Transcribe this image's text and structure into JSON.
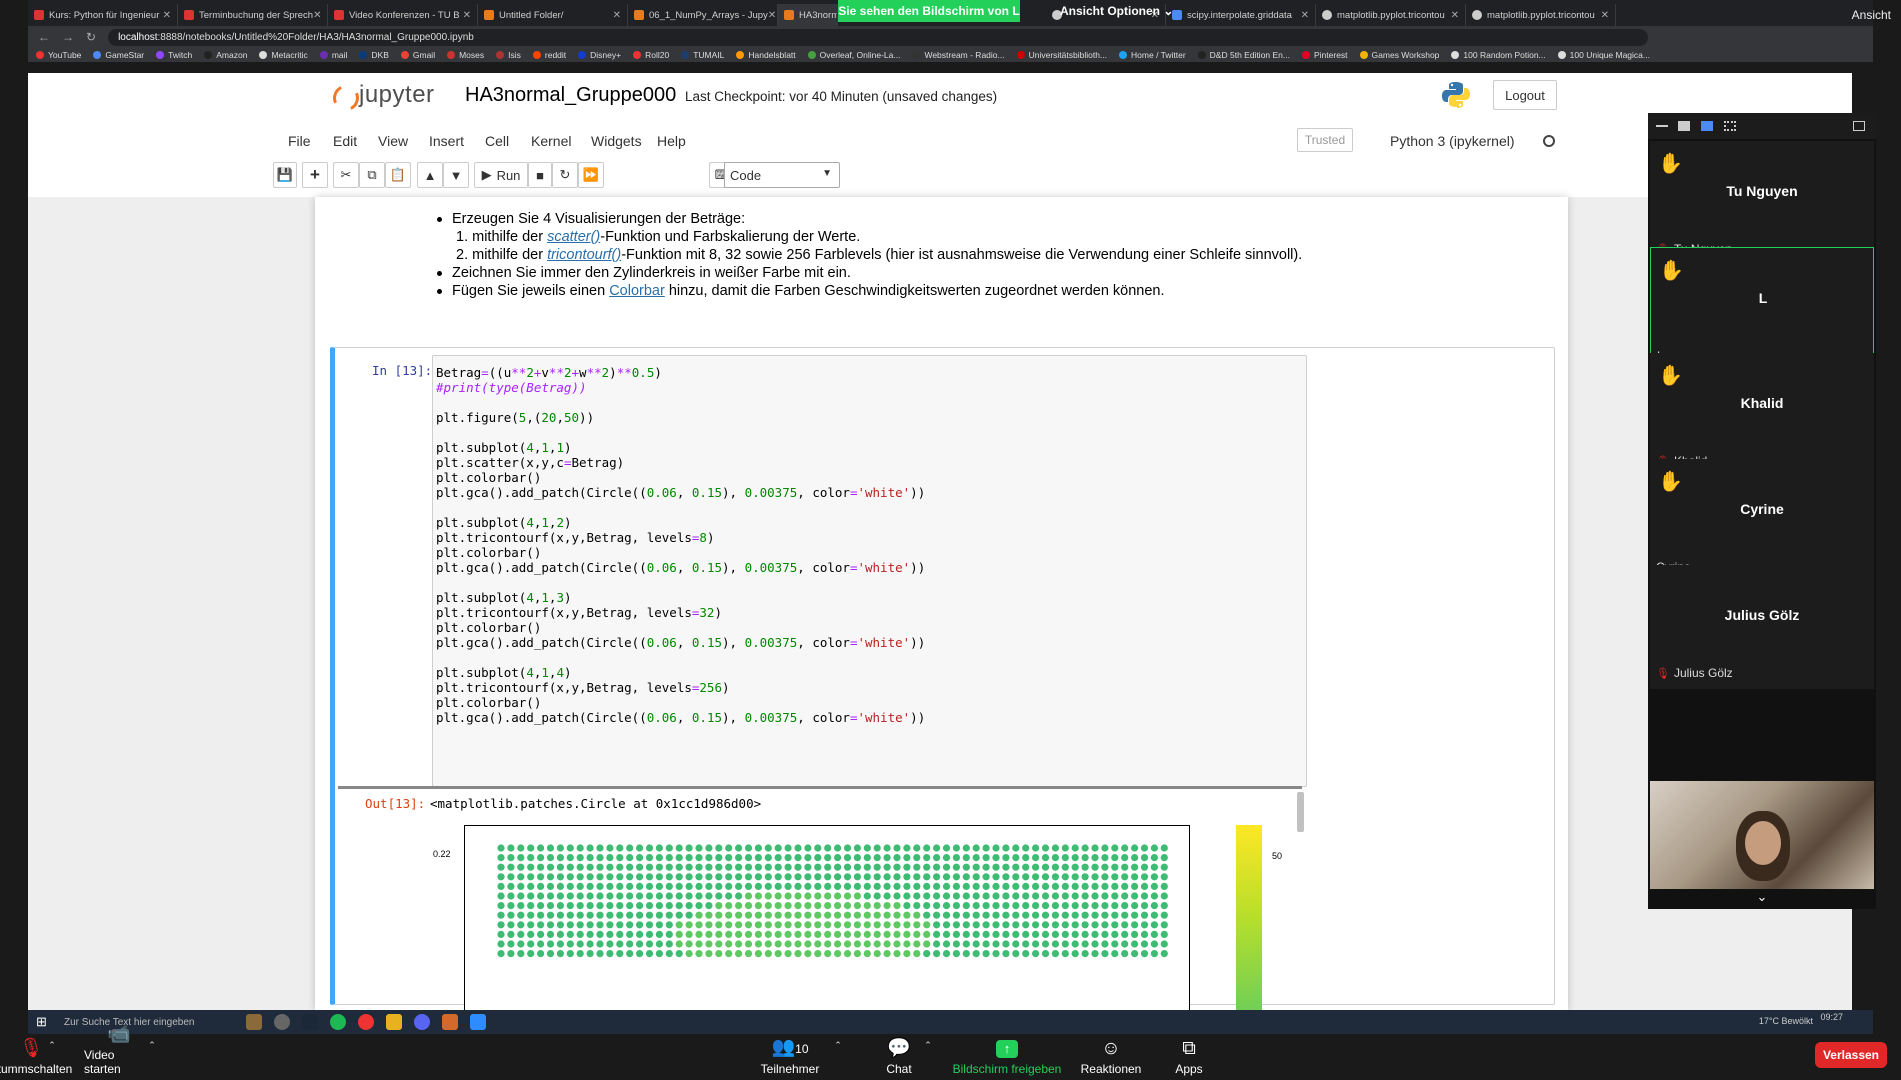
{
  "browser": {
    "tabs": [
      {
        "label": "Kurs: Python für Ingenieur",
        "fav": "red"
      },
      {
        "label": "Terminbuchung der Sprech",
        "fav": "red"
      },
      {
        "label": "Video Konferenzen - TU B",
        "fav": "red"
      },
      {
        "label": "Untitled Folder/",
        "fav": "orange"
      },
      {
        "label": "06_1_NumPy_Arrays - Jupy",
        "fav": "orange"
      },
      {
        "label": "HA3norm",
        "fav": "orange"
      },
      {
        "label": "",
        "fav": "white"
      },
      {
        "label": "scipy.interpolate.griddata",
        "fav": "blue"
      },
      {
        "label": "matplotlib.pyplot.tricontou",
        "fav": "white"
      },
      {
        "label": "matplotlib.pyplot.tricontou",
        "fav": "white"
      }
    ],
    "share_banner": "Sie sehen den Bildschirm von L",
    "view_options": "Ansicht Optionen ⌄",
    "view_right": "Ansicht",
    "url_host": "localhost",
    "url_path": ":8888/notebooks/Untitled%20Folder/HA3/HA3normal_Gruppe000.ipynb",
    "bookmarks": [
      "YouTube",
      "GameStar",
      "Twitch",
      "Amazon",
      "Metacritic",
      "mail",
      "DKB",
      "Gmail",
      "Moses",
      "Isis",
      "reddit",
      "Disney+",
      "Roll20",
      "TUMAIL",
      "Handelsblatt",
      "Overleaf, Online-La...",
      "Webstream - Radio...",
      "Universitätsbiblioth...",
      "Home / Twitter",
      "D&D 5th Edition En...",
      "Pinterest",
      "Games Workshop",
      "100 Random Potion...",
      "100 Unique Magica..."
    ]
  },
  "jupyter": {
    "logo_text": "jupyter",
    "notebook_title": "HA3normal_Gruppe000",
    "checkpoint": "Last Checkpoint: vor 40 Minuten  (unsaved changes)",
    "logout": "Logout",
    "menu": [
      "File",
      "Edit",
      "View",
      "Insert",
      "Cell",
      "Kernel",
      "Widgets",
      "Help"
    ],
    "trusted": "Trusted",
    "kernel": "Python 3 (ipykernel)",
    "run_label": "Run",
    "cell_type": "Code"
  },
  "markdown": {
    "bullet1": "Erzeugen Sie 4 Visualisierungen der Beträge:",
    "item1_pre": "1. mithilfe der ",
    "item1_link": "scatter()",
    "item1_post": "-Funktion und Farbskalierung der Werte.",
    "item2_pre": "2. mithilfe der ",
    "item2_link": "tricontourf()",
    "item2_post": "-Funktion mit 8, 32 sowie 256 Farblevels (hier ist ausnahmsweise die Verwendung einer Schleife sinnvoll).",
    "bullet2": "Zeichnen Sie immer den Zylinderkreis in weißer Farbe mit ein.",
    "bullet3_pre": "Fügen Sie jeweils einen ",
    "bullet3_link": "Colorbar",
    "bullet3_post": " hinzu, damit die Farben Geschwindigkeitswerten zugeordnet werden können."
  },
  "cell": {
    "prompt_in": "In [13]:",
    "prompt_out": "Out[13]:",
    "output_text": "<matplotlib.patches.Circle at 0x1cc1d986d00>",
    "plot_ytick": "0.22",
    "colorbar_tick": "50"
  },
  "zoom": {
    "participants": [
      {
        "name": "Tu Nguyen",
        "label": "Tu Nguyen",
        "muted": true
      },
      {
        "name": "L",
        "label": "L",
        "muted": false
      },
      {
        "name": "Khalid",
        "label": "Khalid",
        "muted": true
      },
      {
        "name": "Cyrine",
        "label": "Cyrine",
        "muted": false
      },
      {
        "name": "Julius Gölz",
        "label": "Julius Gölz",
        "muted": true
      }
    ],
    "controls": {
      "mute": "Stummschalten",
      "video": "Video starten",
      "participants": "Teilnehmer",
      "participants_count": "10",
      "chat": "Chat",
      "share": "Bildschirm freigeben",
      "reactions": "Reaktionen",
      "apps": "Apps",
      "leave": "Verlassen"
    }
  },
  "taskbar": {
    "search": "Zur Suche Text hier eingeben",
    "weather": "17°C  Bewölkt",
    "time": "09:27"
  }
}
